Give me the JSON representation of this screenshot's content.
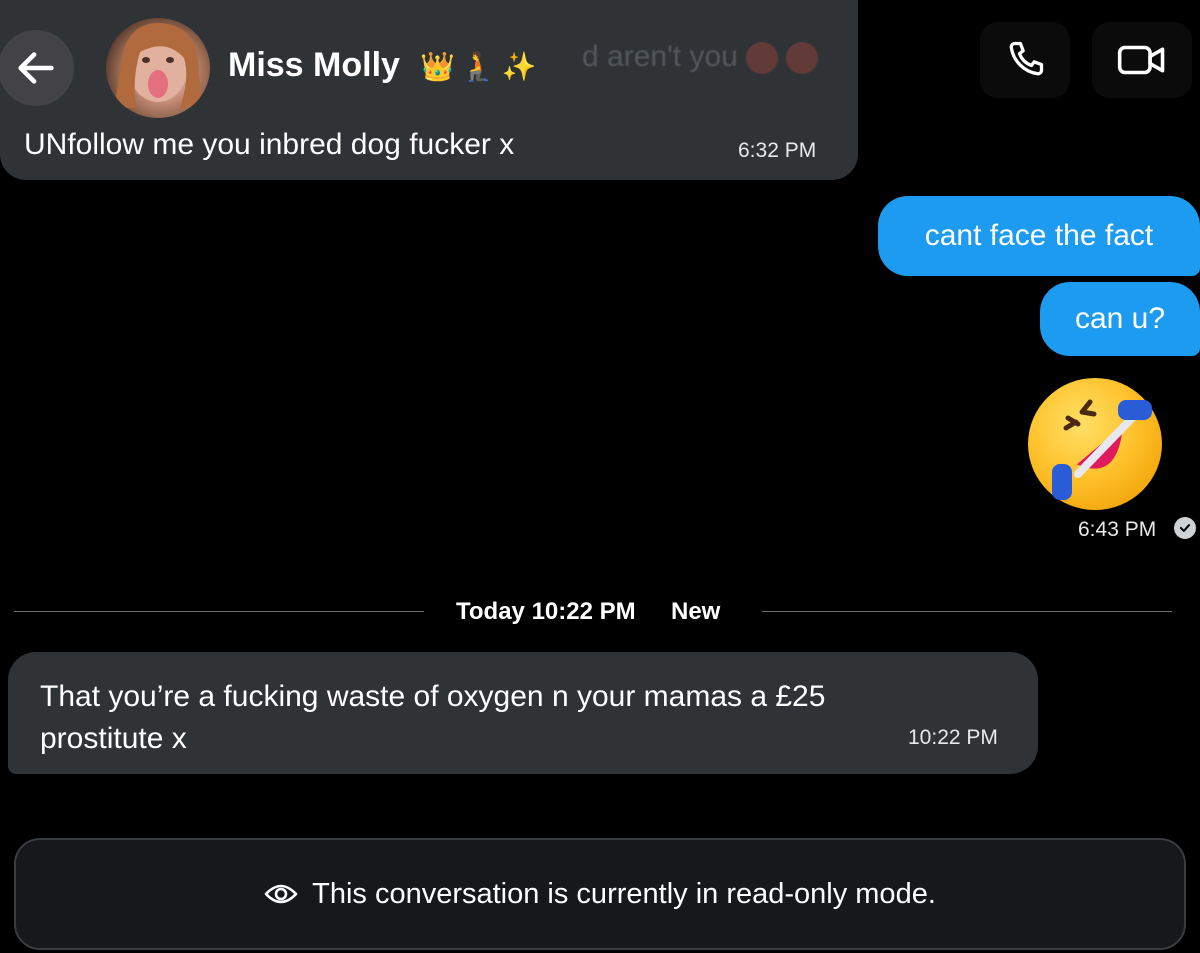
{
  "header": {
    "ghost_preview": "d aren't you",
    "contact_name": "Miss Molly",
    "name_emojis": [
      "👑",
      "🧎",
      "✨"
    ],
    "back_icon": "arrow-left-icon",
    "phone_icon": "phone-icon",
    "video_icon": "video-camera-icon"
  },
  "messages": {
    "incoming_1": {
      "text": "UNfollow me you inbred dog fucker x",
      "time": "6:32 PM"
    },
    "outgoing_1": {
      "text": "cant face the fact"
    },
    "outgoing_2": {
      "text": "can u?"
    },
    "outgoing_emoji": {
      "emoji": "rolling-on-floor-laughing",
      "time": "6:43 PM",
      "status_icon": "check-icon"
    },
    "divider": {
      "label": "Today 10:22 PM",
      "badge": "New"
    },
    "incoming_2": {
      "text": "That you’re a fucking waste of oxygen n your mamas a £25 prostitute x",
      "time": "10:22 PM"
    }
  },
  "footer": {
    "readonly_text": "This conversation is currently in read-only mode.",
    "icon": "eye-icon"
  },
  "colors": {
    "outgoing_bubble": "#1d9bf0",
    "incoming_bubble": "#2f3336",
    "background": "#000000"
  }
}
